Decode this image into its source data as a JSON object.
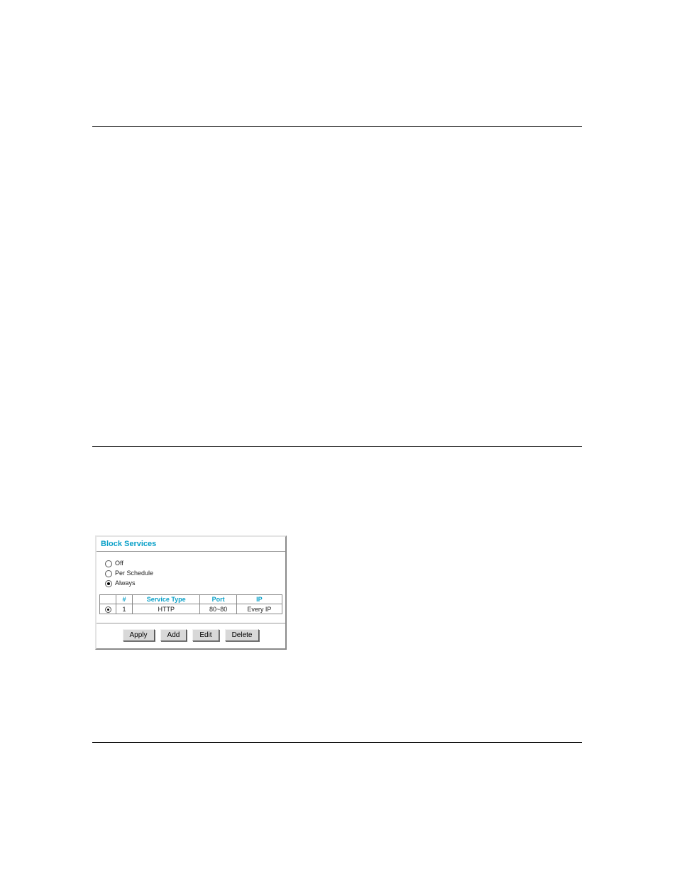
{
  "dialog": {
    "title": "Block Services",
    "modes": {
      "off": {
        "label": "Off",
        "selected": false
      },
      "per_schedule": {
        "label": "Per Schedule",
        "selected": false
      },
      "always": {
        "label": "Always",
        "selected": true
      }
    },
    "columns": {
      "num": "#",
      "service_type": "Service Type",
      "port": "Port",
      "ip": "IP"
    },
    "rows": [
      {
        "selected": true,
        "num": "1",
        "service_type": "HTTP",
        "port": "80~80",
        "ip": "Every IP"
      }
    ],
    "buttons": {
      "apply": "Apply",
      "add": "Add",
      "edit": "Edit",
      "delete": "Delete"
    }
  }
}
